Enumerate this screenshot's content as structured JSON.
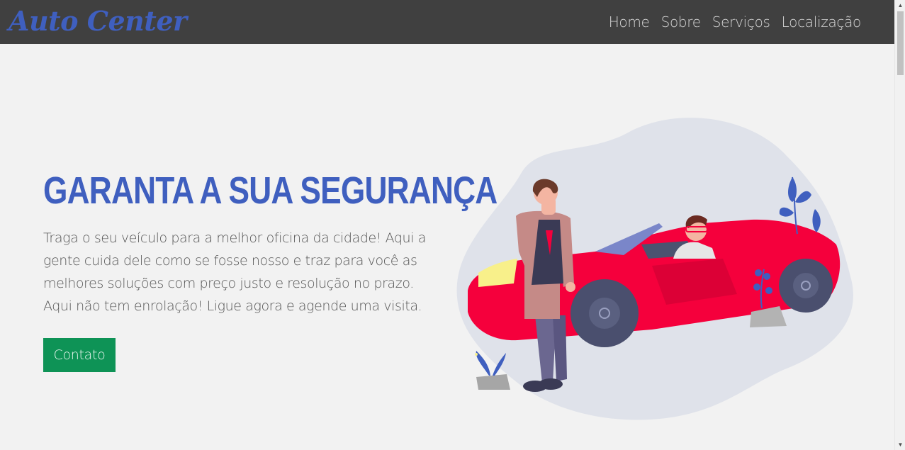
{
  "navbar": {
    "logo": "Auto Center",
    "links": [
      "Home",
      "Sobre",
      "Serviços",
      "Localização"
    ]
  },
  "hero": {
    "title": "GARANTA A SUA SEGURANÇA",
    "description": "Traga o seu veículo para a melhor oficina da cidade! Aqui a gente cuida dele como se fosse nosso e traz para você as melhores soluções com preço justo e resolução no prazo. Aqui não tem enrolação! Ligue agora e agende uma visita.",
    "cta_label": "Contato"
  },
  "colors": {
    "navbar_bg": "#404040",
    "brand_blue": "#3f5fbf",
    "cta_green": "#0e9356",
    "page_bg": "#f2f2f2",
    "car_red": "#f5003c"
  }
}
